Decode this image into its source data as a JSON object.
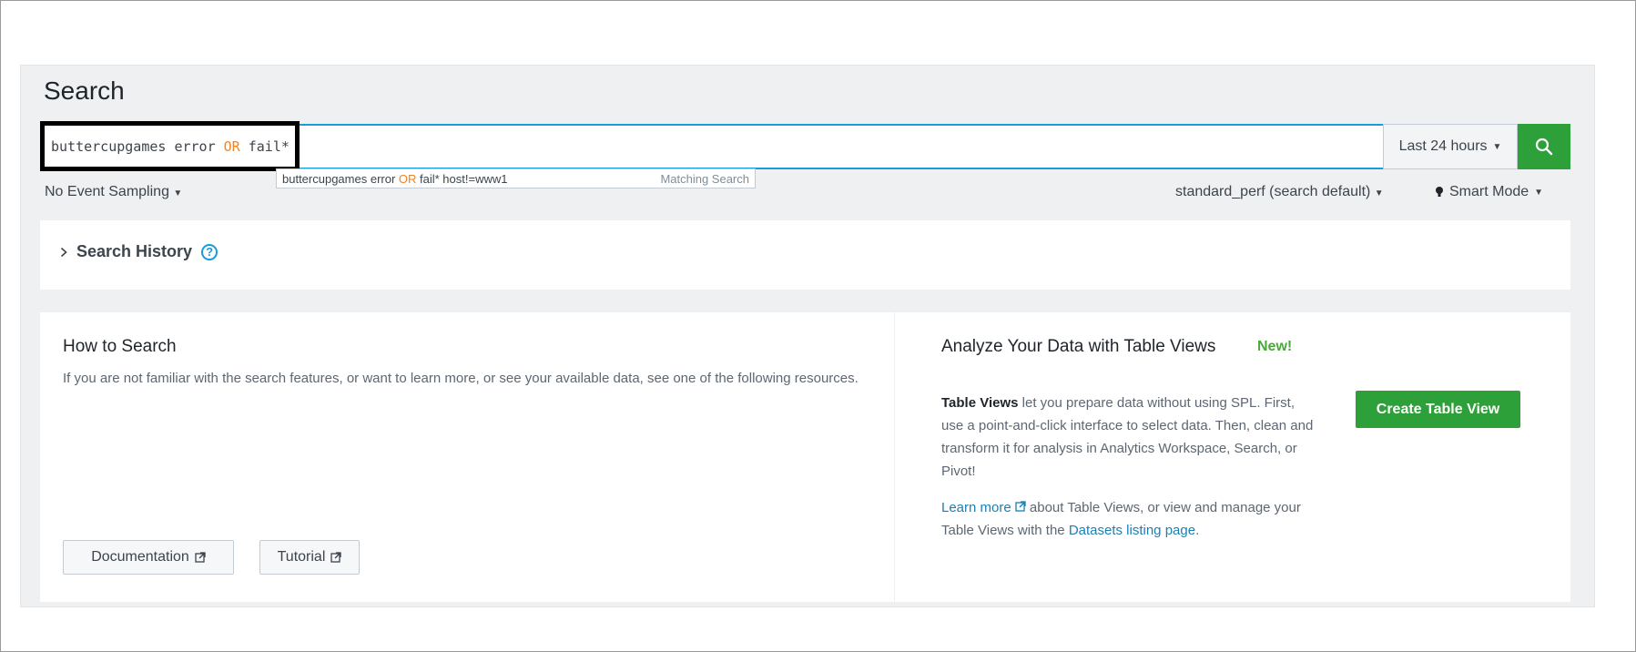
{
  "page": {
    "title": "Search"
  },
  "search": {
    "query_part1": "buttercupgames error ",
    "query_or": "OR",
    "query_part2": " fail*",
    "time_range": "Last 24 hours",
    "suggestion": {
      "part1": "buttercupgames error ",
      "or": "OR",
      "part2": " fail* host!=www1",
      "meta": "Matching Search"
    }
  },
  "toolbar": {
    "sampling": "No Event Sampling",
    "workload": "standard_perf (search default)",
    "mode": "Smart Mode"
  },
  "history": {
    "label": "Search History",
    "help": "?"
  },
  "how_to": {
    "title": "How to Search",
    "text": "If you are not familiar with the search features, or want to learn more, or see your available data, see one of the following resources.",
    "documentation": "Documentation",
    "tutorial": "Tutorial"
  },
  "table_views": {
    "title": "Analyze Your Data with Table Views",
    "new_badge": "New!",
    "bold": "Table Views",
    "text": " let you prepare data without using SPL. First, use a point-and-click interface to select data. Then, clean and transform it for analysis in Analytics Workspace, Search, or Pivot!",
    "learn_more": "Learn more",
    "more_text": " about Table Views, or view and manage your Table Views with the ",
    "datasets_link": "Datasets listing page",
    "period": ".",
    "create_button": "Create Table View"
  },
  "colors": {
    "accent_blue": "#1a9cd8",
    "primary_green": "#2ea039",
    "keyword_orange": "#f58220",
    "new_green": "#4aa93a"
  },
  "icons": [
    "search-icon",
    "caret-down-icon",
    "chevron-right-icon",
    "help-icon",
    "external-link-icon",
    "lightbulb-icon"
  ]
}
